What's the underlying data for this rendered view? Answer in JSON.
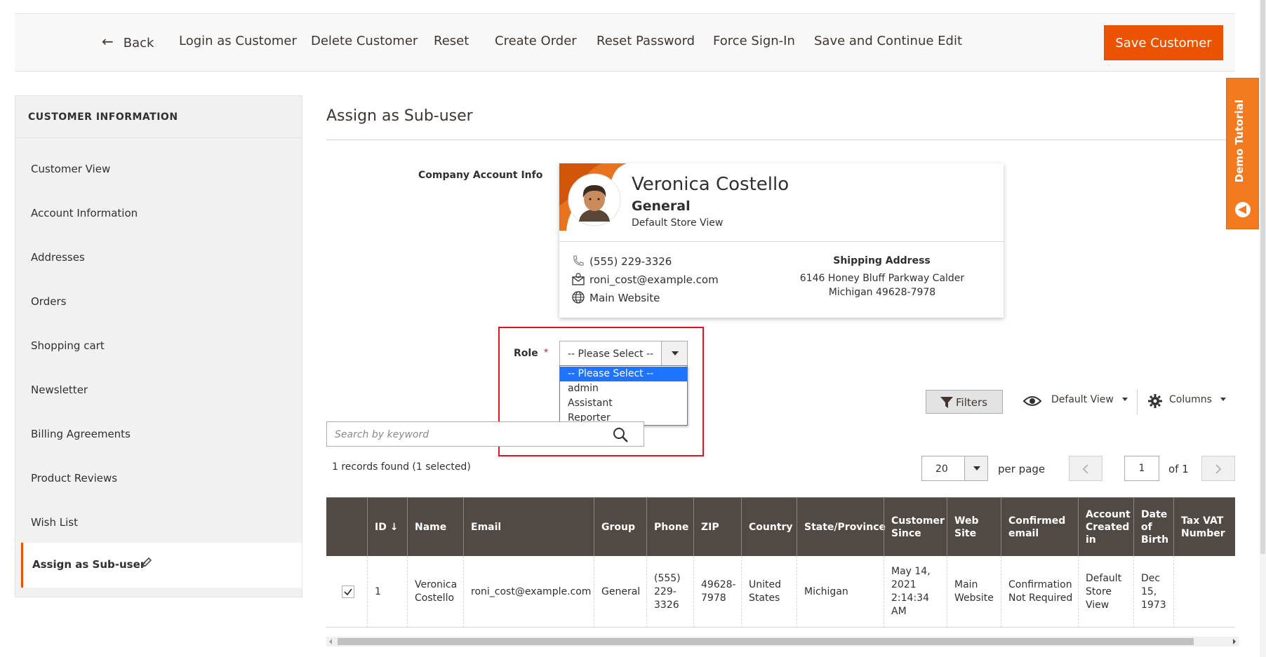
{
  "toolbar": {
    "back": "Back",
    "login_as_customer": "Login as Customer",
    "delete_customer": "Delete Customer",
    "reset": "Reset",
    "create_order": "Create Order",
    "reset_password": "Reset Password",
    "force_sign_in": "Force Sign-In",
    "save_and_continue": "Save and Continue Edit",
    "save_customer": "Save Customer"
  },
  "sidebar": {
    "title": "CUSTOMER INFORMATION",
    "items": [
      {
        "label": "Customer View"
      },
      {
        "label": "Account Information"
      },
      {
        "label": "Addresses"
      },
      {
        "label": "Orders"
      },
      {
        "label": "Shopping cart"
      },
      {
        "label": "Newsletter"
      },
      {
        "label": "Billing Agreements"
      },
      {
        "label": "Product Reviews"
      },
      {
        "label": "Wish List"
      }
    ],
    "active": "Assign as Sub-user"
  },
  "main": {
    "title": "Assign as Sub-user",
    "company_account_label": "Company Account Info"
  },
  "card": {
    "name": "Veronica Costello",
    "group": "General",
    "store": "Default Store View",
    "phone": "(555) 229-3326",
    "email": "roni_cost@example.com",
    "website": "Main Website",
    "shipping_heading": "Shipping Address",
    "shipping_line1": "6146 Honey Bluff Parkway Calder",
    "shipping_line2": "Michigan 49628-7978"
  },
  "role": {
    "label": "Role",
    "required_mark": "*",
    "selected": "-- Please Select --",
    "options": [
      "-- Please Select --",
      "admin",
      "Assistant",
      "Reporter"
    ]
  },
  "search": {
    "placeholder": "Search by keyword"
  },
  "grid": {
    "filters": "Filters",
    "view": "Default View",
    "columns": "Columns",
    "records": "1 records found (1 selected)",
    "per_page_value": "20",
    "per_page_label": "per page",
    "page": "1",
    "of_pages": "of 1"
  },
  "table": {
    "headers": {
      "id": "ID ↓",
      "name": "Name",
      "email": "Email",
      "group": "Group",
      "phone": "Phone",
      "zip": "ZIP",
      "country": "Country",
      "state": "State/Province",
      "since": "Customer Since",
      "website": "Web Site",
      "confirmed": "Confirmed email",
      "created_in": "Account Created in",
      "dob": "Date of Birth",
      "tax": "Tax VAT Number"
    },
    "row": {
      "checked": true,
      "id": "1",
      "name": "Veronica Costello",
      "email": "roni_cost@example.com",
      "group": "General",
      "phone": "(555) 229-3326",
      "zip": "49628-7978",
      "country": "United States",
      "state": "Michigan",
      "since": "May 14, 2021 2:14:34 AM",
      "website": "Main Website",
      "confirmed": "Confirmation Not Required",
      "created_in": "Default Store View",
      "dob": "Dec 15, 1973",
      "tax": ""
    }
  },
  "demo_tab": {
    "label": "Demo Tutorial"
  },
  "colors": {
    "accent": "#eb5202",
    "table_header": "#514943",
    "selection_blue": "#1e74ff",
    "highlight_red": "#e0141e",
    "demo_orange": "#f37a1f"
  },
  "icons": {
    "back": "arrow-left-icon",
    "phone": "phone-icon",
    "email": "envelope-icon",
    "website": "globe-icon",
    "search": "magnifier-icon",
    "filters": "funnel-icon",
    "view": "eye-icon",
    "columns": "gear-icon",
    "edit": "pencil-icon"
  }
}
